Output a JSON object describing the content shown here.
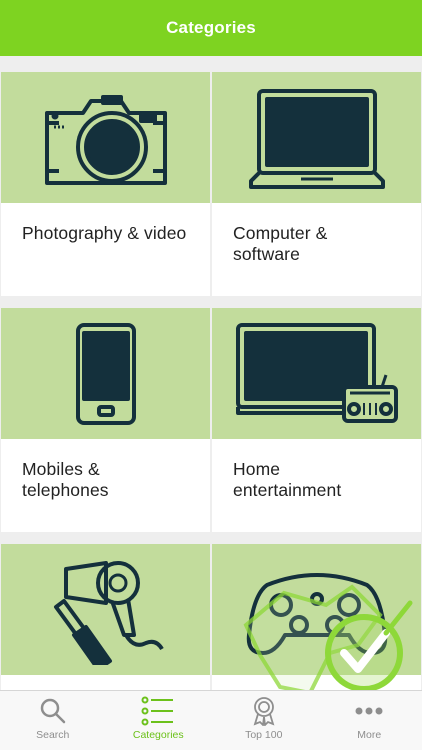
{
  "header": {
    "title": "Categories"
  },
  "categories": [
    {
      "label": "Photography & video",
      "icon": "camera-icon"
    },
    {
      "label": "Computer &\nsoftware",
      "icon": "laptop-icon"
    },
    {
      "label": "Mobiles &\ntelephones",
      "icon": "smartphone-icon"
    },
    {
      "label": "Home\nentertainment",
      "icon": "tv-radio-icon"
    },
    {
      "label": "",
      "icon": "hairdryer-lipstick-icon"
    },
    {
      "label": "",
      "icon": "game-controller-icon"
    }
  ],
  "tabs": [
    {
      "label": "Search",
      "icon": "search-icon",
      "active": false
    },
    {
      "label": "Categories",
      "icon": "list-icon",
      "active": true
    },
    {
      "label": "Top 100",
      "icon": "award-icon",
      "active": false
    },
    {
      "label": "More",
      "icon": "more-dots-icon",
      "active": false
    }
  ],
  "colors": {
    "header_bg": "#7ed321",
    "tile_bg": "#c2dc9c",
    "icon_stroke": "#14303c",
    "active_tab": "#6cc11b",
    "inactive_tab": "#8e8e8e"
  }
}
